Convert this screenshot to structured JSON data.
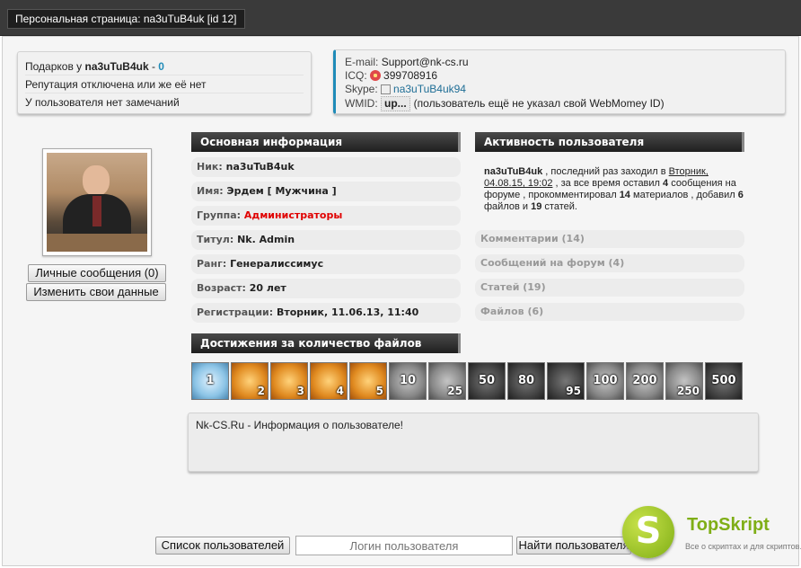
{
  "window": {
    "title": "Персональная страница: na3uTuB4uk [id 12]"
  },
  "gifts": {
    "label": "Подарков у",
    "user": "na3uTuB4uk",
    "separator": " - ",
    "count": "0",
    "reputation": "Репутация отключена или же её нет",
    "remarks": "У пользователя нет замечаний"
  },
  "contacts": {
    "email_label": "E-mail:",
    "email": "Support@nk-cs.ru",
    "icq_label": "ICQ:",
    "icq": "399708916",
    "skype_label": "Skype:",
    "skype": "na3uTuB4uk94",
    "wmid_label": "WMID:",
    "wmid_badge": "up...",
    "wmid_note": "(пользователь ещё не указал свой WebMomey ID)"
  },
  "profile_buttons": {
    "messages": "Личные сообщения (0)",
    "edit": "Изменить свои данные"
  },
  "main_info": {
    "header": "Основная информация",
    "rows": [
      {
        "key": "Ник:",
        "value": "na3uTuB4uk"
      },
      {
        "key": "Имя:",
        "value": "Эрдем [ Мужчина ]"
      },
      {
        "key": "Группа:",
        "value": "Администраторы"
      },
      {
        "key": "Титул:",
        "value": "Nk. Admin"
      },
      {
        "key": "Ранг:",
        "value": "Генералиссимус"
      },
      {
        "key": "Возраст:",
        "value": "20 лет"
      },
      {
        "key": "Регистрации:",
        "value": "Вторник, 11.06.13, 11:40"
      }
    ]
  },
  "activity": {
    "header": "Активность пользователя",
    "user": "na3uTuB4uk",
    "t1": ", последний раз заходил в",
    "last_visit": "Вторник, 04.08.15, 19:02",
    "t2": ", за все время оставил",
    "forum_count": "4",
    "t3": "сообщения на форуме , прокомментировал",
    "comment_count": "14",
    "t4": "материалов , добавил",
    "files_count": "6",
    "t5": "файлов и",
    "articles_count": "19",
    "t6": "статей.",
    "stats": [
      "Комментарии (14)",
      "Сообщений на форум (4)",
      "Статей (19)",
      "Файлов (6)"
    ]
  },
  "achievements": {
    "header": "Достижения за количество файлов",
    "badges": [
      "1",
      "2",
      "3",
      "4",
      "5",
      "10",
      "25",
      "50",
      "80",
      "95",
      "100",
      "200",
      "250",
      "500"
    ]
  },
  "about": {
    "text": "Nk-CS.Ru - Информация о пользователе!"
  },
  "footer": {
    "list_button": "Список пользователей",
    "login_placeholder": "Логин пользователя",
    "find_button": "Найти пользователя"
  },
  "logo": {
    "letter": "S",
    "name": "TopSkript",
    "tagline": "Все о скриптах и для скриптов..."
  },
  "colors": {
    "accent": "#1f8bb8",
    "red": "#e00000",
    "logo_green": "#7fae16"
  }
}
